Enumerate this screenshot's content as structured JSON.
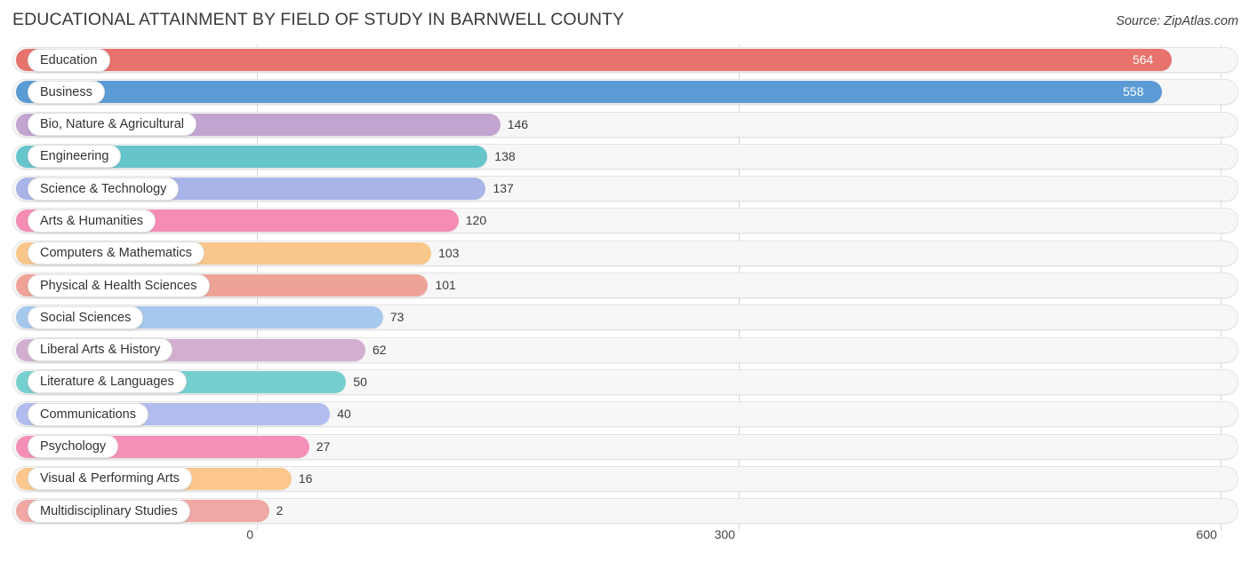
{
  "header": {
    "title": "EDUCATIONAL ATTAINMENT BY FIELD OF STUDY IN BARNWELL COUNTY",
    "source": "Source: ZipAtlas.com"
  },
  "chart_data": {
    "type": "bar",
    "orientation": "horizontal",
    "title": "EDUCATIONAL ATTAINMENT BY FIELD OF STUDY IN BARNWELL COUNTY",
    "xlabel": "",
    "ylabel": "",
    "xlim": [
      0,
      600
    ],
    "xticks": [
      0,
      300,
      600
    ],
    "xtick_labels": [
      "0",
      "300",
      "600"
    ],
    "grid": true,
    "legend": false,
    "categories": [
      "Education",
      "Business",
      "Bio, Nature & Agricultural",
      "Engineering",
      "Science & Technology",
      "Arts & Humanities",
      "Computers & Mathematics",
      "Physical & Health Sciences",
      "Social Sciences",
      "Liberal Arts & History",
      "Literature & Languages",
      "Communications",
      "Psychology",
      "Visual & Performing Arts",
      "Multidisciplinary Studies"
    ],
    "values": [
      564,
      558,
      146,
      138,
      137,
      120,
      103,
      101,
      73,
      62,
      50,
      40,
      27,
      16,
      2
    ],
    "value_labels": [
      "564",
      "558",
      "146",
      "138",
      "137",
      "120",
      "103",
      "101",
      "73",
      "62",
      "50",
      "40",
      "27",
      "16",
      "2"
    ],
    "colors": [
      "#e8726c",
      "#5b9bd5",
      "#c3a3d0",
      "#66c5cb",
      "#a9b4e8",
      "#f58cb4",
      "#fac78a",
      "#efa298",
      "#a5c8ec",
      "#d2afd0",
      "#76cfcf",
      "#b2bcee",
      "#f490b8",
      "#fbc78c",
      "#efa8a3"
    ],
    "label_inside": [
      true,
      true,
      false,
      false,
      false,
      false,
      false,
      false,
      false,
      false,
      false,
      false,
      false,
      false,
      false
    ]
  },
  "axis": {
    "ticks": [
      "0",
      "300",
      "600"
    ]
  }
}
